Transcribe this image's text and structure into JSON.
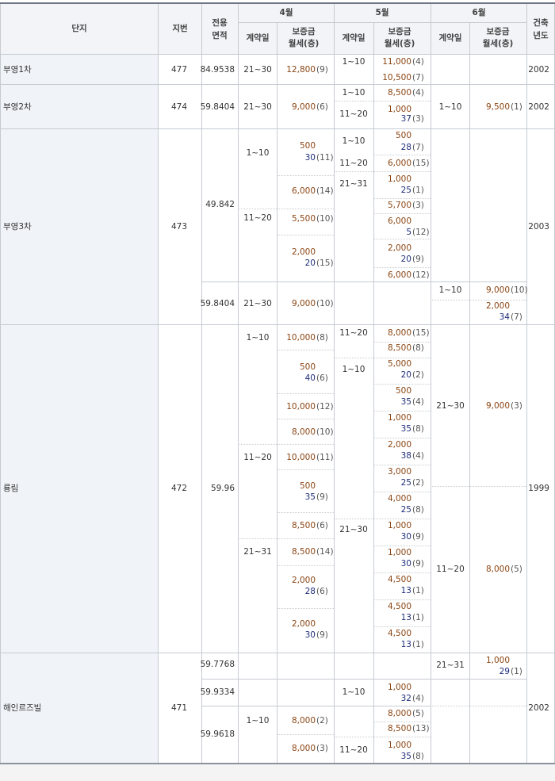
{
  "table": {
    "headers": {
      "complex": "단지",
      "lot": "지번",
      "area": [
        "전용",
        "면적"
      ],
      "month4": "4월",
      "month5": "5월",
      "month6": "6월",
      "built": [
        "건축",
        "년도"
      ],
      "contract_day": "계약일",
      "deposit_rent": [
        "보증금",
        "월세(층)"
      ]
    },
    "complexes": [
      "부영1차",
      "부영2차",
      "부영3차",
      "룡림",
      "해인르즈빌"
    ],
    "lots": [
      "477",
      "474",
      "473",
      "472",
      "471"
    ],
    "build_years": [
      "2002",
      "2002",
      "2003",
      "1999",
      "2002"
    ],
    "areas": [
      "84.9538",
      "59.8404",
      "49.842",
      "59.8404",
      "59.96",
      "59.7768",
      "59.9334",
      "59.9618"
    ],
    "day_ranges": [
      "21~30",
      "1~10",
      "1~10",
      "11~20",
      "21~30",
      "1~10",
      "1~10",
      "1~10",
      "11~20",
      "21~31",
      "11~20",
      "21~30",
      "1~10",
      "1~10",
      "11~20",
      "1~10",
      "11~20",
      "21~30",
      "21~31",
      "21~30",
      "11~20",
      "21~31",
      "1~10",
      "1~10",
      "11~20"
    ],
    "deals": [
      {
        "dep": "12,800",
        "floor": "(9)"
      },
      {
        "dep": "11,000",
        "floor": "(4)"
      },
      {
        "dep": "10,500",
        "floor": "(7)"
      },
      {
        "dep": "9,000",
        "floor": "(6)"
      },
      {
        "dep": "8,500",
        "floor": "(4)"
      },
      {
        "dep": "1,000",
        "rent": "37",
        "floor": "(3)"
      },
      {
        "dep": "9,500",
        "floor": "(1)"
      },
      {
        "dep": "500",
        "rent": "30",
        "floor": "(11)"
      },
      {
        "dep": "6,000",
        "floor": "(14)"
      },
      {
        "dep": "5,500",
        "floor": "(10)"
      },
      {
        "dep": "2,000",
        "rent": "20",
        "floor": "(15)"
      },
      {
        "dep": "500",
        "rent": "28",
        "floor": "(7)"
      },
      {
        "dep": "6,000",
        "floor": "(15)"
      },
      {
        "dep": "1,000",
        "rent": "25",
        "floor": "(1)"
      },
      {
        "dep": "5,700",
        "floor": "(3)"
      },
      {
        "dep": "6,000",
        "rent": "5",
        "floor": "(12)"
      },
      {
        "dep": "2,000",
        "rent": "20",
        "floor": "(9)"
      },
      {
        "dep": "6,000",
        "floor": "(12)"
      },
      {
        "dep": "9,000",
        "floor": "(10)"
      },
      {
        "dep": "9,000",
        "floor": "(10)"
      },
      {
        "dep": "2,000",
        "rent": "34",
        "floor": "(7)"
      },
      {
        "dep": "10,000",
        "floor": "(8)"
      },
      {
        "dep": "500",
        "rent": "40",
        "floor": "(6)"
      },
      {
        "dep": "10,000",
        "floor": "(12)"
      },
      {
        "dep": "8,000",
        "floor": "(10)"
      },
      {
        "dep": "10,000",
        "floor": "(11)"
      },
      {
        "dep": "500",
        "rent": "35",
        "floor": "(9)"
      },
      {
        "dep": "8,500",
        "floor": "(6)"
      },
      {
        "dep": "8,500",
        "floor": "(14)"
      },
      {
        "dep": "2,000",
        "rent": "28",
        "floor": "(6)"
      },
      {
        "dep": "2,000",
        "rent": "30",
        "floor": "(9)"
      },
      {
        "dep": "8,000",
        "floor": "(15)"
      },
      {
        "dep": "8,500",
        "floor": "(8)"
      },
      {
        "dep": "5,000",
        "rent": "20",
        "floor": "(2)"
      },
      {
        "dep": "500",
        "rent": "35",
        "floor": "(4)"
      },
      {
        "dep": "1,000",
        "rent": "35",
        "floor": "(8)"
      },
      {
        "dep": "2,000",
        "rent": "38",
        "floor": "(4)"
      },
      {
        "dep": "3,000",
        "rent": "25",
        "floor": "(2)"
      },
      {
        "dep": "4,000",
        "rent": "25",
        "floor": "(8)"
      },
      {
        "dep": "1,000",
        "rent": "30",
        "floor": "(9)"
      },
      {
        "dep": "1,000",
        "rent": "30",
        "floor": "(9)"
      },
      {
        "dep": "4,500",
        "rent": "13",
        "floor": "(1)"
      },
      {
        "dep": "4,500",
        "rent": "13",
        "floor": "(1)"
      },
      {
        "dep": "4,500",
        "rent": "13",
        "floor": "(1)"
      },
      {
        "dep": "9,000",
        "floor": "(3)"
      },
      {
        "dep": "8,000",
        "floor": "(5)"
      },
      {
        "dep": "1,000",
        "rent": "29",
        "floor": "(1)"
      },
      {
        "dep": "1,000",
        "rent": "32",
        "floor": "(4)"
      },
      {
        "dep": "8,000",
        "floor": "(2)"
      },
      {
        "dep": "8,000",
        "floor": "(3)"
      },
      {
        "dep": "8,000",
        "floor": "(5)"
      },
      {
        "dep": "8,500",
        "floor": "(13)"
      },
      {
        "dep": "1,000",
        "rent": "35",
        "floor": "(8)"
      }
    ]
  }
}
